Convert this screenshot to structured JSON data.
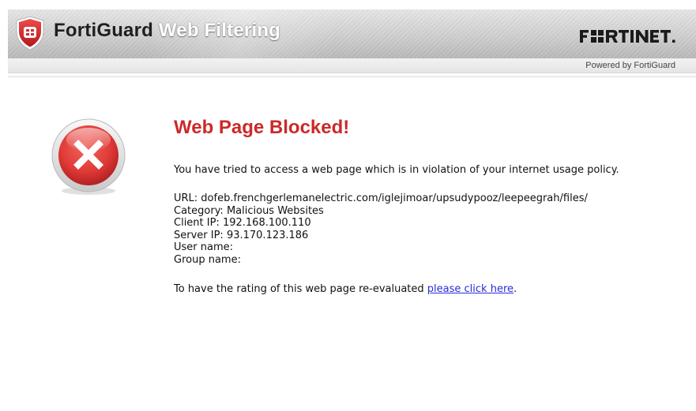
{
  "header": {
    "brand_bold": "FortiGuard",
    "brand_light": "Web Filtering",
    "vendor_logo": "FÜRTINET.",
    "powered_by": "Powered by FortiGuard"
  },
  "main": {
    "title": "Web Page Blocked!",
    "description": "You have tried to access a web page which is in violation of your internet usage policy.",
    "details": {
      "url": "URL: dofeb.frenchgerlemanelectric.com/iglejimoar/upsudypooz/leepeegrah/files/",
      "category": "Category: Malicious Websites",
      "client_ip": "Client IP: 192.168.100.110",
      "server_ip": "Server IP: 93.170.123.186",
      "user_name": "User name:",
      "group_name": "Group name:"
    },
    "reevaluate_text": "To have the rating of this web page re-evaluated ",
    "reevaluate_link": "please click here",
    "reevaluate_suffix": "."
  },
  "icons": {
    "brand": "fortiguard-shield-icon",
    "status": "error-x-icon"
  },
  "colors": {
    "title_red": "#cc2929",
    "link_blue": "#2b2bd8",
    "shield_red": "#d9262b",
    "error_red": "#e03a36"
  }
}
